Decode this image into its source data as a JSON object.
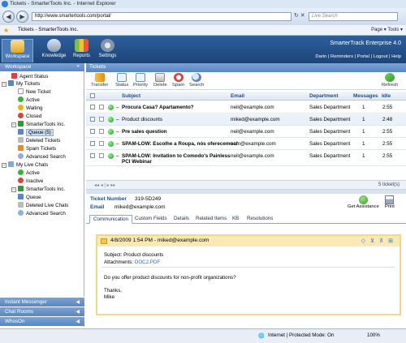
{
  "browser": {
    "window_title": "Tickets - SmarterTools Inc. - Internet Explorer",
    "url": "http://www.smartertools.com/portal/",
    "search_placeholder": "Live Search",
    "favorites_tab": "Tickets - SmarterTools Inc.",
    "tools": "Page ▾  Tools ▾"
  },
  "app": {
    "nav": [
      {
        "label": "Workspace"
      },
      {
        "label": "Knowledge"
      },
      {
        "label": "Reports"
      },
      {
        "label": "Settings"
      }
    ],
    "product": "SmarterTrack Enterprise 4.0",
    "user_links": "Darin | Reminders | Portal | Logout | Help"
  },
  "sidebar": {
    "header": "Workspace",
    "items": [
      {
        "label": "Agent Status"
      },
      {
        "label": "My Tickets"
      },
      {
        "label": "New Ticket"
      },
      {
        "label": "Active"
      },
      {
        "label": "Waiting"
      },
      {
        "label": "Closed"
      },
      {
        "label": "SmarterTools Inc."
      },
      {
        "label": "Queue (5)"
      },
      {
        "label": "Deleted Tickets"
      },
      {
        "label": "Spam Tickets"
      },
      {
        "label": "Advanced Search"
      },
      {
        "label": "My Live Chats"
      },
      {
        "label": "Active"
      },
      {
        "label": "Inactive"
      },
      {
        "label": "SmarterTools Inc."
      },
      {
        "label": "Queue"
      },
      {
        "label": "Deleted Live Chats"
      },
      {
        "label": "Advanced Search"
      }
    ],
    "panels": [
      "Instant Messenger",
      "Chat Rooms",
      "WhosOn"
    ]
  },
  "tickets": {
    "header": "Tickets",
    "toolbar": [
      "Transfer",
      "Status",
      "Priority",
      "Delete",
      "Spam",
      "Search"
    ],
    "refresh": "Refresh",
    "columns": {
      "subject": "Subject",
      "email": "Email",
      "department": "Department",
      "messages": "Messages",
      "idle": "Idle"
    },
    "rows": [
      {
        "subject": "Procura Casa? Apartamento?",
        "email": "neil@example.com",
        "department": "Sales Department",
        "messages": "1",
        "idle": "2:55"
      },
      {
        "subject": "Product discounts",
        "email": "miked@example.com",
        "department": "Sales Department",
        "messages": "1",
        "idle": "2:48"
      },
      {
        "subject": "Pre sales question",
        "email": "neil@example.com",
        "department": "Sales Department",
        "messages": "1",
        "idle": "2:55"
      },
      {
        "subject": "SPAM-LOW: Escolhe a Roupa, nós oferecemos!",
        "email": "sam@example.com",
        "department": "Sales Department",
        "messages": "1",
        "idle": "2:55"
      },
      {
        "subject": "SPAM-LOW: Invitation to Comodo's Painless",
        "subject2": "PCI Webinar",
        "email": "neil@example.com",
        "department": "Sales Department",
        "messages": "1",
        "idle": "2:55"
      }
    ],
    "pager_count": "5 ticket(s)"
  },
  "detail": {
    "ticket_number_label": "Ticket Number",
    "ticket_number": "319-5D249",
    "email_label": "Email",
    "email": "miked@example.com",
    "get_assistance": "Get Assistance",
    "print": "Print",
    "tabs": [
      "Communication",
      "Custom Fields",
      "Details",
      "Related Items",
      "KB",
      "Resolutions"
    ],
    "message": {
      "header": "4/8/2009 1:54 PM - miked@example.com",
      "subject_label": "Subject:",
      "subject": "Product discounts",
      "attachments_label": "Attachments:",
      "attachment": "DOC2.PDF",
      "body": "Do you offer product discounts for non-profit organizations?",
      "thanks": "Thanks,",
      "signature": "Mike"
    }
  },
  "statusbar": {
    "zone": "Internet | Protected Mode: On",
    "zoom": "100%"
  }
}
